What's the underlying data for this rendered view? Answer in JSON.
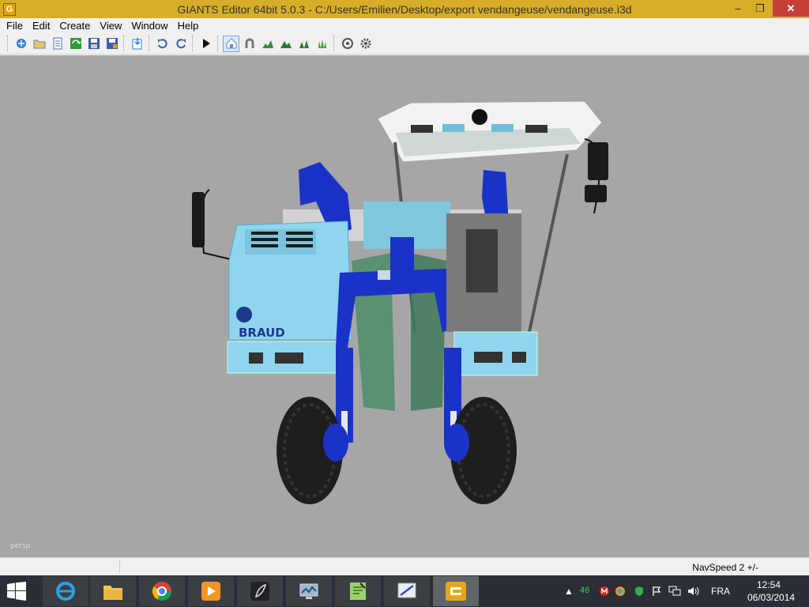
{
  "window": {
    "app_icon_letter": "G",
    "title": "GIANTS Editor 64bit 5.0.3 - C:/Users/Emilien/Desktop/export vendangeuse/vendangeuse.i3d",
    "minimize_glyph": "–",
    "maximize_glyph": "❐",
    "close_glyph": "✕"
  },
  "menu": {
    "items": [
      {
        "label": "File"
      },
      {
        "label": "Edit"
      },
      {
        "label": "Create"
      },
      {
        "label": "View"
      },
      {
        "label": "Window"
      },
      {
        "label": "Help"
      }
    ]
  },
  "toolbar": {
    "buttons": [
      {
        "name": "new-icon",
        "color": "#3a7fd4"
      },
      {
        "name": "open-icon",
        "color": "#5a86c0"
      },
      {
        "name": "document-icon",
        "color": "#4b6fb5"
      },
      {
        "name": "refresh-icon",
        "color": "#2e9a3a"
      },
      {
        "name": "save-icon",
        "color": "#3a5da8"
      },
      {
        "name": "save-as-icon",
        "color": "#3a5da8"
      },
      {
        "name": "import-icon",
        "color": "#2e7bd1"
      },
      {
        "name": "undo-icon",
        "color": "#2f63b0"
      },
      {
        "name": "redo-icon",
        "color": "#2f63b0"
      },
      {
        "name": "play-icon",
        "color": "#111111"
      },
      {
        "name": "home-icon",
        "color": "#5f8fd0"
      },
      {
        "name": "magnet-icon",
        "color": "#777777"
      },
      {
        "name": "terrain-paint-icon",
        "color": "#3a8a3a"
      },
      {
        "name": "terrain-sculpt-icon",
        "color": "#2e7a2e"
      },
      {
        "name": "foliage-icon",
        "color": "#2e7a2e"
      },
      {
        "name": "grass-icon",
        "color": "#3f9f2f"
      },
      {
        "name": "particle-icon",
        "color": "#555555"
      },
      {
        "name": "settings-gear-icon",
        "color": "#555555"
      }
    ]
  },
  "viewport": {
    "camera_label": "persp",
    "background": "#a6a6a6",
    "model_brand_text": "BRAUD"
  },
  "status": {
    "nav_speed": "NavSpeed 2 +/-"
  },
  "taskbar": {
    "tray_counter": "46",
    "language": "FRA",
    "time": "12:54",
    "date": "06/03/2014",
    "apps": [
      {
        "name": "internet-explorer-icon"
      },
      {
        "name": "file-explorer-icon"
      },
      {
        "name": "chrome-icon"
      },
      {
        "name": "media-player-icon"
      },
      {
        "name": "app-feather-icon"
      },
      {
        "name": "monitor-app-icon"
      },
      {
        "name": "notepad-app-icon"
      },
      {
        "name": "design-app-icon"
      },
      {
        "name": "giants-editor-icon"
      }
    ]
  }
}
